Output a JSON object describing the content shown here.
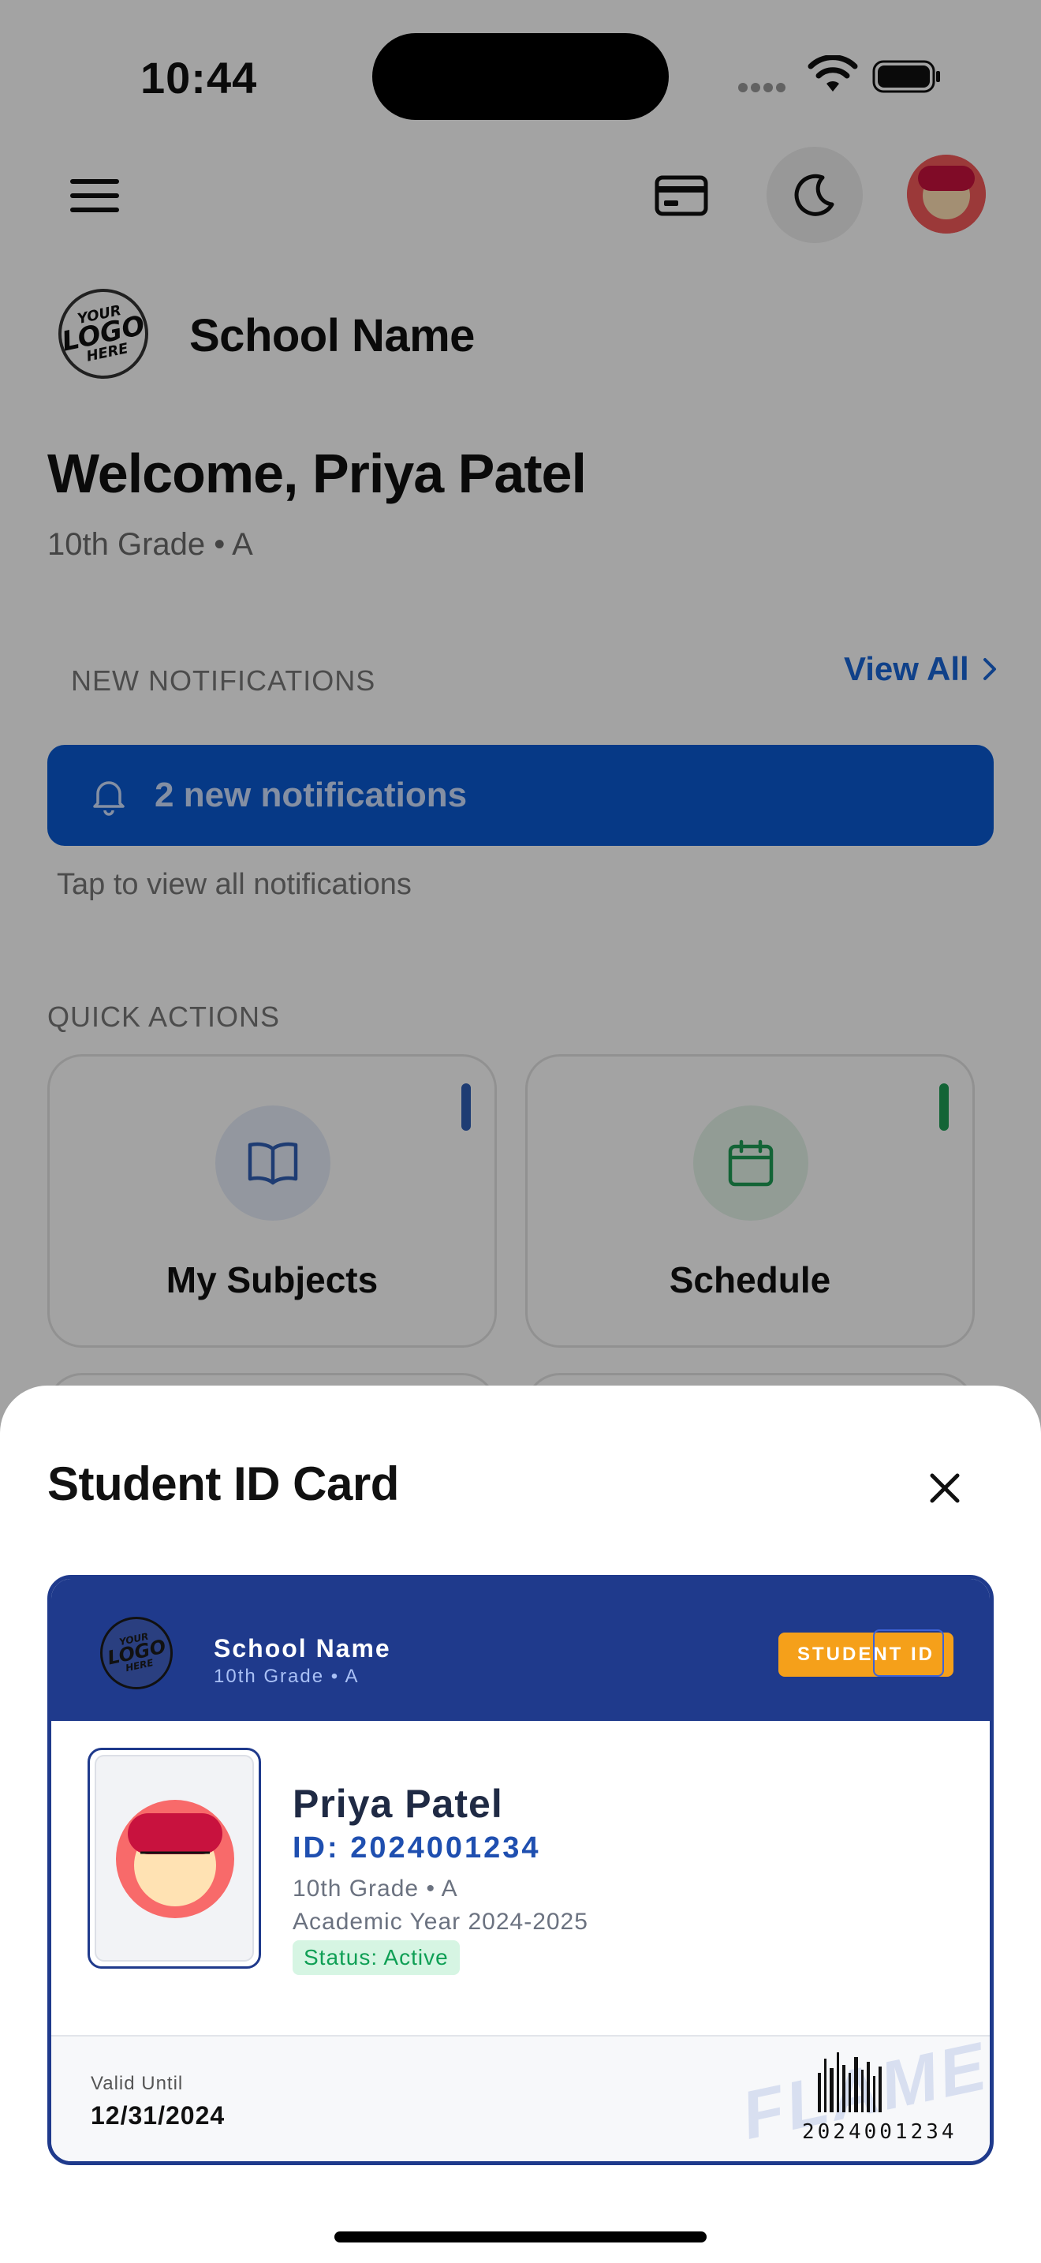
{
  "status_bar": {
    "time": "10:44"
  },
  "header": {
    "menu_icon": "hamburger-menu-icon",
    "card_icon": "credit-card-icon",
    "theme_icon": "moon-icon"
  },
  "school": {
    "logo_text_lines": [
      "YOUR",
      "LOGO",
      "HERE"
    ],
    "name": "School Name"
  },
  "welcome": {
    "title": "Welcome, Priya Patel",
    "subtitle": "10th Grade • A"
  },
  "notifications": {
    "section_label": "NEW NOTIFICATIONS",
    "view_all": "View All",
    "banner_text": "2 new notifications",
    "hint": "Tap to view all notifications",
    "accent": "#0a5ad2"
  },
  "quick_actions": {
    "section_label": "QUICK ACTIONS",
    "items": [
      {
        "label": "My Subjects",
        "icon": "book-icon",
        "color": "#2f5fb4"
      },
      {
        "label": "Schedule",
        "icon": "calendar-icon",
        "color": "#1f9d55"
      }
    ]
  },
  "sheet": {
    "title": "Student ID Card",
    "close_icon": "close-icon"
  },
  "id_card": {
    "school_name": "School Name",
    "grade": "10th Grade • A",
    "badge": "STUDENT ID",
    "student_name": "Priya Patel",
    "student_id": "ID: 2024001234",
    "grade_line": "10th Grade • A",
    "academic_year": "Academic Year 2024-2025",
    "status": "Status: Active",
    "valid_label": "Valid Until",
    "valid_date": "12/31/2024",
    "watermark": "FLAME",
    "barcode_number": "2024001234",
    "primary_color": "#1f3a8c",
    "badge_color": "#f5a01a"
  }
}
